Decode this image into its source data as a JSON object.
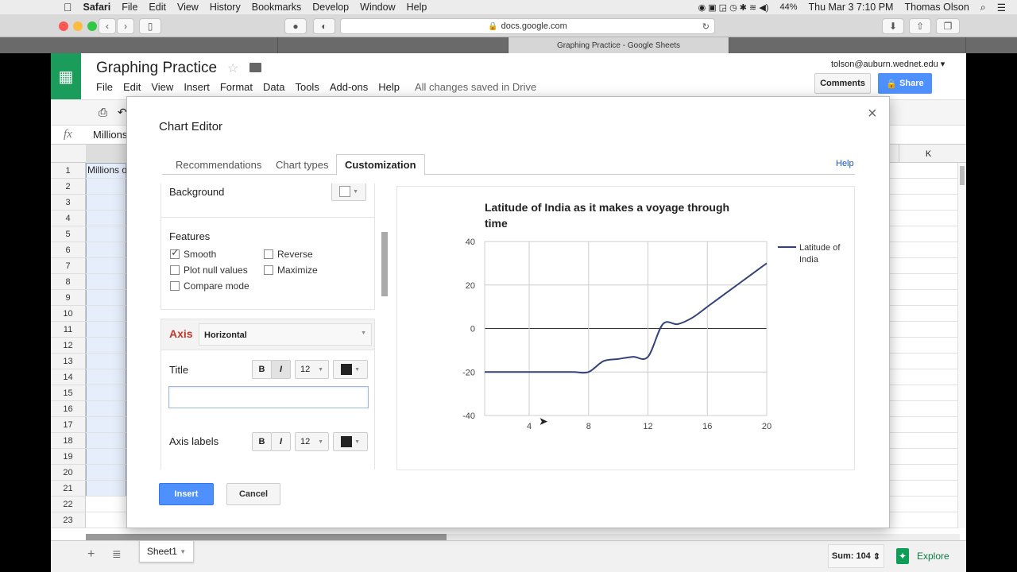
{
  "mac_menubar": {
    "app": "Safari",
    "items": [
      "File",
      "Edit",
      "View",
      "History",
      "Bookmarks",
      "Develop",
      "Window",
      "Help"
    ],
    "battery": "44%",
    "clock": "Thu Mar 3  7:10 PM",
    "user": "Thomas Olson"
  },
  "browser": {
    "url": "docs.google.com",
    "active_tab": "Graphing Practice - Google Sheets"
  },
  "sheets": {
    "title": "Graphing Practice",
    "menu": [
      "File",
      "Edit",
      "View",
      "Insert",
      "Format",
      "Data",
      "Tools",
      "Add-ons",
      "Help"
    ],
    "save_status": "All changes saved in Drive",
    "account": "tolson@auburn.wednet.edu",
    "comments_label": "Comments",
    "share_label": "Share",
    "formula_value": "Millions",
    "cell_a1": "Millions o",
    "column_k": "K",
    "rows": [
      "1",
      "2",
      "3",
      "4",
      "5",
      "6",
      "7",
      "8",
      "9",
      "10",
      "11",
      "12",
      "13",
      "14",
      "15",
      "16",
      "17",
      "18",
      "19",
      "20",
      "21",
      "22",
      "23"
    ],
    "sheet_tab": "Sheet1",
    "sum": "Sum: 104",
    "explore": "Explore"
  },
  "chart_editor": {
    "title": "Chart Editor",
    "tabs": [
      "Recommendations",
      "Chart types",
      "Customization"
    ],
    "active_tab": "Customization",
    "help": "Help",
    "background_label": "Background",
    "features_label": "Features",
    "features": [
      {
        "label": "Smooth",
        "checked": true
      },
      {
        "label": "Reverse",
        "checked": false
      },
      {
        "label": "Plot null values",
        "checked": false
      },
      {
        "label": "Maximize",
        "checked": false
      },
      {
        "label": "Compare mode",
        "checked": false
      }
    ],
    "axis_label": "Axis",
    "axis_select": "Horizontal",
    "title_label": "Title",
    "title_value": "",
    "axis_labels_label": "Axis labels",
    "font_size": "12",
    "bold": "B",
    "italic": "I",
    "insert": "Insert",
    "cancel": "Cancel"
  },
  "chart_data": {
    "type": "line",
    "smooth": true,
    "title": "Latitude of India as it makes a voyage through time",
    "xlabel": "",
    "ylabel": "",
    "x": [
      1,
      2,
      3,
      4,
      5,
      6,
      7,
      8,
      9,
      10,
      11,
      12,
      13,
      14,
      15,
      16,
      17,
      18,
      19,
      20
    ],
    "series": [
      {
        "name": "Latitude of India",
        "color": "#34427a",
        "values": [
          -20,
          -20,
          -20,
          -20,
          -20,
          -20,
          -20,
          -20,
          -15,
          -14,
          -13,
          -13,
          2,
          2,
          5,
          10,
          15,
          20,
          25,
          30
        ]
      }
    ],
    "xlim": [
      1,
      20
    ],
    "ylim": [
      -40,
      40
    ],
    "xticks": [
      "4",
      "8",
      "12",
      "16",
      "20"
    ],
    "yticks": [
      "40",
      "20",
      "0",
      "-20",
      "-40"
    ],
    "grid": true,
    "legend": "right"
  }
}
